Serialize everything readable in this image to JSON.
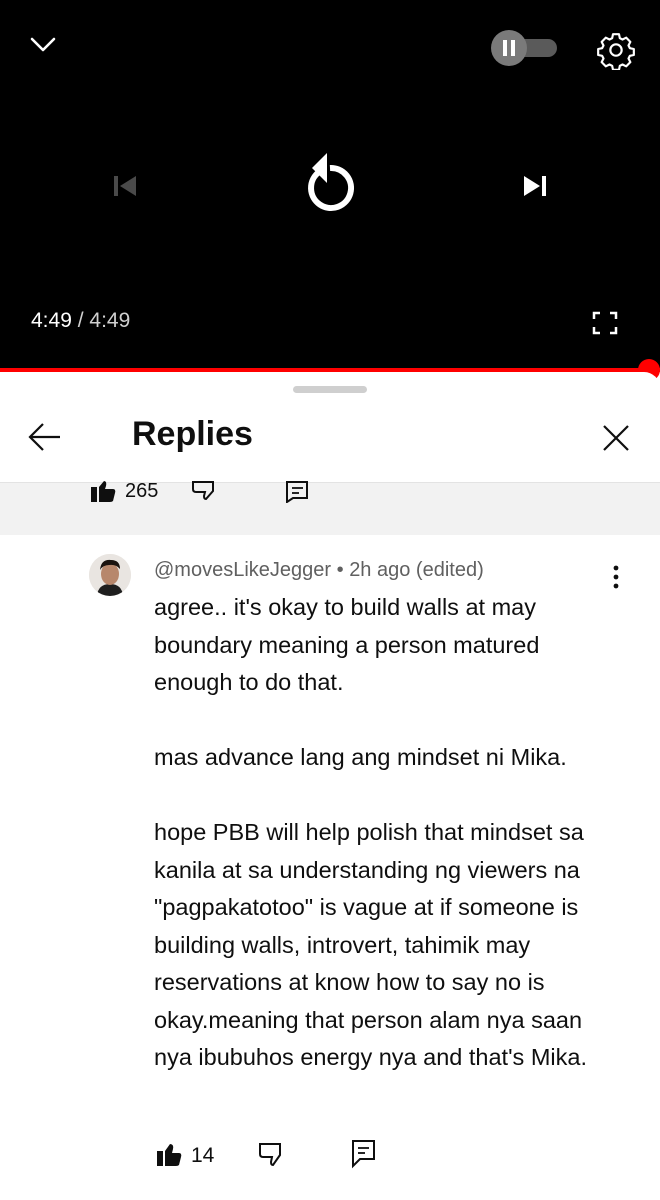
{
  "player": {
    "current_time": "4:49",
    "separator": " / ",
    "duration": "4:49",
    "progress": 1.0,
    "autoplay_on": true
  },
  "panel": {
    "title": "Replies"
  },
  "parent_comment": {
    "like_count": "265"
  },
  "reply": {
    "author": "@movesLikeJegger",
    "dot": " • ",
    "time": "2h ago (edited)",
    "paragraphs": [
      "agree.. it's okay to build walls at may boundary meaning a person matured enough to do that.",
      "mas advance lang ang mindset ni Mika.",
      "hope PBB will help polish that mindset sa kanila at sa understanding ng viewers na \"pagpakatotoo\" is vague at if someone is building walls, introvert, tahimik may reservations at know how to say no is okay.meaning that person alam nya saan nya ibubuhos energy nya and that's Mika."
    ],
    "like_count": "14"
  },
  "colors": {
    "accent": "#ff0000",
    "player_bg": "#000000",
    "text": "#0f0f0f",
    "secondary_text": "#606060"
  }
}
